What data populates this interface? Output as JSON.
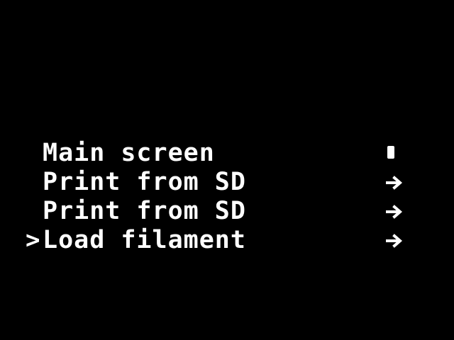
{
  "screen": {
    "background_color": "#000000",
    "text_color": "#ffffff"
  },
  "menu": {
    "cursor_glyph": ">",
    "selected_index": 3,
    "items": [
      {
        "label": "Main screen",
        "indicator": "back-marker-icon"
      },
      {
        "label": "Print from SD",
        "indicator": "right-arrow-icon"
      },
      {
        "label": "Print from SD",
        "indicator": "right-arrow-icon"
      },
      {
        "label": "Load filament",
        "indicator": "right-arrow-icon"
      }
    ]
  }
}
